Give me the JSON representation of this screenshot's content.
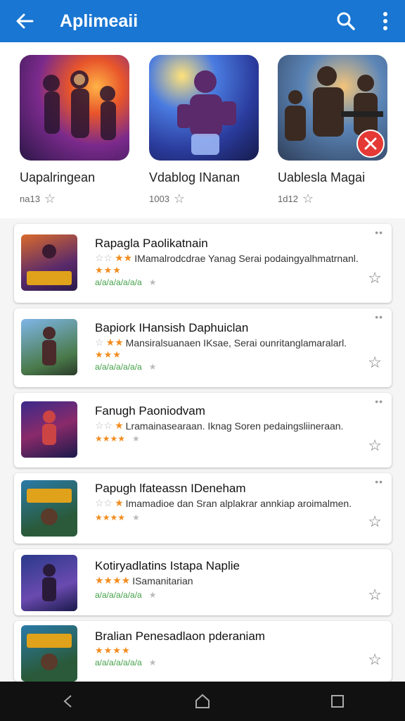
{
  "appbar": {
    "title": "Aplimeaii",
    "color": "#1976d2"
  },
  "featured": [
    {
      "name": "Uapalringean",
      "meta": "na13",
      "icon": "game-art-heroes"
    },
    {
      "name": "Vdablog INanan",
      "meta": "1003",
      "icon": "game-art-armored-hero"
    },
    {
      "name": "Uablesla Magai",
      "meta": "1d12",
      "icon": "game-art-soldiers"
    }
  ],
  "list": [
    {
      "title": "Rapagla Paolikatnain",
      "desc": "IMamalrodcdrae Yanag Serai podaingyalhmatrnanl.",
      "rating": "★★★",
      "sub": "a/a/a/a/a/a/a"
    },
    {
      "title": "Bapiork IHansish Daphuiclan",
      "desc": "Mansiralsuanaen IKsae, Serai ounritanglamaralarl.",
      "rating": "★★★",
      "sub": "a/a/a/a/a/a/a"
    },
    {
      "title": "Fanugh Paoniodvam",
      "desc": "Lramainasearaan. Iknag Soren pedaingsliineraan.",
      "rating": "★★★★",
      "sub": ""
    },
    {
      "title": "Papugh lfateassn IDeneham",
      "desc": "Imamadioe dan Sran alplakrar annkiap aroimalmen.",
      "rating": "★★★★",
      "sub": ""
    },
    {
      "title": "Kotiryadlatins Istapa Naplie",
      "desc": "ISamanitarian",
      "rating": "★★★★",
      "sub": "a/a/a/a/a/a/a"
    },
    {
      "title": "Bralian Penesadlaon pderaniam",
      "desc": "",
      "rating": "★★★★",
      "sub": "a/a/a/a/a/a/a"
    }
  ]
}
